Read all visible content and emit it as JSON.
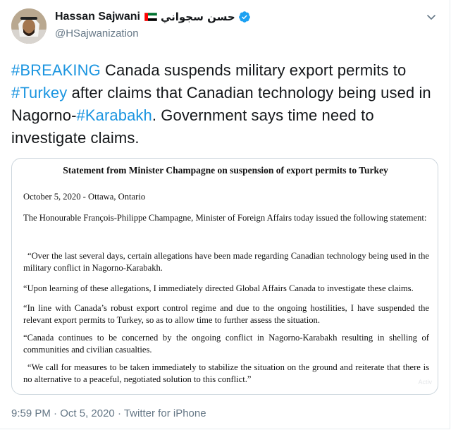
{
  "author": {
    "name": "Hassan Sajwani",
    "name_arabic": "حسن سجواني",
    "handle": "@HSajwanization",
    "flag": "uae-flag-icon",
    "verified_icon": "verified-badge-icon",
    "avatar_icon": "avatar-image"
  },
  "menu_icon": "chevron-down-icon",
  "tweet": {
    "segments": [
      {
        "text": "#BREAKING",
        "hashtag": true
      },
      {
        "text": " Canada suspends military export permits to ",
        "hashtag": false
      },
      {
        "text": "#Turkey",
        "hashtag": true
      },
      {
        "text": " after claims that Canadian technology being used in Nagorno-",
        "hashtag": false
      },
      {
        "text": "#Karabakh",
        "hashtag": true
      },
      {
        "text": ". Government says time need to investigate claims.",
        "hashtag": false
      }
    ]
  },
  "media": {
    "title": "Statement from Minister Champagne on suspension of export permits to Turkey",
    "date": "October 5, 2020 - Ottawa, Ontario",
    "paragraphs": [
      "The Honourable François-Philippe Champagne, Minister of Foreign Affairs today issued the following statement:",
      "“Over the last several days, certain allegations have been made regarding Canadian technology being used in the military conflict in Nagorno-Karabakh.",
      "“Upon learning of these allegations, I immediately directed Global Affairs Canada to investigate these claims.",
      "“In line with Canada’s robust export control regime and due to the ongoing hostilities, I have suspended the relevant export permits to Turkey, so as to allow time to further assess the situation.",
      "“Canada continues to be concerned by the ongoing conflict in Nagorno-Karabakh resulting in shelling of communities and civilian casualties.",
      "“We call for measures to be taken immediately to stabilize the situation on the ground and reiterate that there is no alternative to a peaceful, negotiated solution to this conflict.”"
    ],
    "watermark": "Activ"
  },
  "footer": {
    "time": "9:59 PM",
    "separator": " · ",
    "date": "Oct 5, 2020",
    "source": "Twitter for iPhone"
  },
  "colors": {
    "link": "#1b95e0",
    "secondary_text": "#657786",
    "verified": "#1da1f2",
    "border": "#ccd6dd"
  }
}
